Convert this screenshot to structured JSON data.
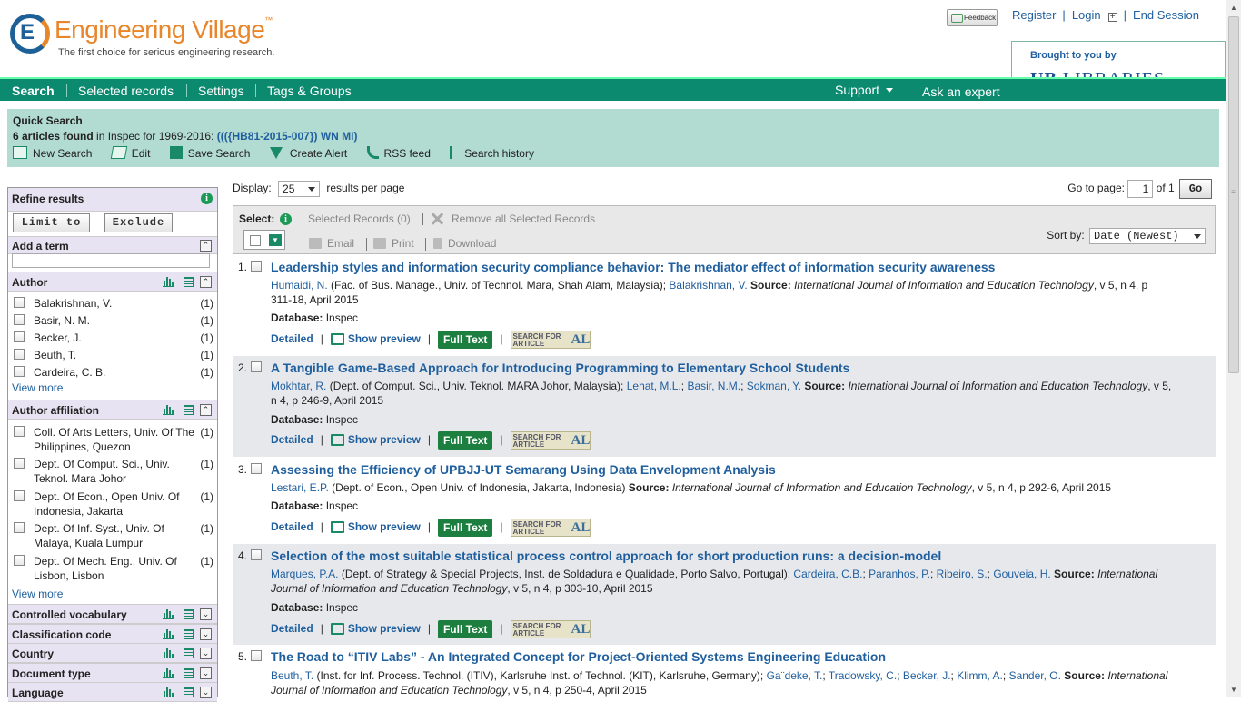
{
  "header": {
    "logo_title": "Engineering Village",
    "logo_tm": "™",
    "tagline": "The first choice for serious engineering research.",
    "feedback": "Feedback",
    "links": [
      "Register",
      "Login",
      "End Session"
    ],
    "brought_by": "Brought to you by",
    "library_ub": "UB",
    "library_name": "LIBRARIES"
  },
  "nav": {
    "items": [
      "Search",
      "Selected records",
      "Settings",
      "Tags & Groups"
    ],
    "support": "Support",
    "ask": "Ask an expert"
  },
  "quick_search": {
    "title": "Quick Search",
    "count_text": "6 articles found",
    "in_text": " in Inspec for 1969-2016: ",
    "query": "((({HB81-2015-007}) WN MI)",
    "actions": [
      "New Search",
      "Edit",
      "Save Search",
      "Create Alert",
      "RSS feed",
      "Search history"
    ]
  },
  "refine": {
    "title": "Refine results",
    "limit": "Limit to",
    "exclude": "Exclude",
    "add_term": "Add a term",
    "author_title": "Author",
    "authors": [
      {
        "name": "Balakrishnan, V.",
        "count": "(1)"
      },
      {
        "name": "Basir, N. M.",
        "count": "(1)"
      },
      {
        "name": "Becker, J.",
        "count": "(1)"
      },
      {
        "name": "Beuth, T.",
        "count": "(1)"
      },
      {
        "name": "Cardeira, C. B.",
        "count": "(1)"
      }
    ],
    "view_more": "View more",
    "affil_title": "Author affiliation",
    "affiliations": [
      {
        "name": "Coll. Of Arts Letters, Univ. Of The Philippines, Quezon",
        "count": "(1)"
      },
      {
        "name": "Dept. Of Comput. Sci., Univ. Teknol. Mara Johor",
        "count": "(1)"
      },
      {
        "name": "Dept. Of Econ., Open Univ. Of Indonesia, Jakarta",
        "count": "(1)"
      },
      {
        "name": "Dept. Of Inf. Syst., Univ. Of Malaya, Kuala Lumpur",
        "count": "(1)"
      },
      {
        "name": "Dept. Of Mech. Eng., Univ. Of Lisbon, Lisbon",
        "count": "(1)"
      }
    ],
    "collapsed": [
      "Controlled vocabulary",
      "Classification code",
      "Country",
      "Document type",
      "Language"
    ]
  },
  "results": {
    "display_label": "Display:",
    "per_page": "25",
    "per_page_label": "results per page",
    "goto_label": "Go to page:",
    "page": "1",
    "of_label": "of 1",
    "go": "Go",
    "select_label": "Select:",
    "selected_records": "Selected Records (0)",
    "remove_all": "Remove all Selected Records",
    "email": "Email",
    "print": "Print",
    "download": "Download",
    "sort_label": "Sort by:",
    "sort_value": "Date (Newest)",
    "detailed": "Detailed",
    "show_preview": "Show preview",
    "full_text": "Full Text",
    "sfa_line1": "SEARCH FOR",
    "sfa_line2": "ARTICLE",
    "sfa_al": "AL",
    "database_label": "Database:",
    "database_value": " Inspec",
    "source_label": "Source:",
    "records": [
      {
        "num": "1.",
        "title": "Leadership styles and information security compliance behavior: The mediator effect of information security awareness",
        "authors": [
          {
            "name": "Humaidi, N.",
            "aff": " (Fac. of Bus. Manage., Univ. of Technol. Mara, Shah Alam, Malaysia); "
          },
          {
            "name": "Balakrishnan, V.",
            "aff": " "
          }
        ],
        "source": "International Journal of Information and Education Technology",
        "source_rest": ", v 5, n 4, p 311-18, April 2015"
      },
      {
        "num": "2.",
        "title": "A Tangible Game-Based Approach for Introducing Programming to Elementary School Students",
        "authors": [
          {
            "name": "Mokhtar, R.",
            "aff": " (Dept. of Comput. Sci., Univ. Teknol. MARA Johor, Malaysia); "
          },
          {
            "name": "Lehat, M.L.",
            "aff": "; "
          },
          {
            "name": "Basir, N.M.",
            "aff": "; "
          },
          {
            "name": "Sokman, Y.",
            "aff": " "
          }
        ],
        "source": "International Journal of Information and Education Technology",
        "source_rest": ", v 5, n 4, p 246-9, April 2015"
      },
      {
        "num": "3.",
        "title": "Assessing the Efficiency of UPBJJ-UT Semarang Using Data Envelopment Analysis",
        "authors": [
          {
            "name": "Lestari, E.P.",
            "aff": " (Dept. of Econ., Open Univ. of Indonesia, Jakarta, Indonesia) "
          }
        ],
        "source": "International Journal of Information and Education Technology",
        "source_rest": ", v 5, n 4, p 292-6, April 2015"
      },
      {
        "num": "4.",
        "title": "Selection of the most suitable statistical process control approach for short production runs: a decision-model",
        "authors": [
          {
            "name": "Marques, P.A.",
            "aff": " (Dept. of Strategy & Special Projects, Inst. de Soldadura e Qualidade, Porto Salvo, Portugal); "
          },
          {
            "name": "Cardeira, C.B.",
            "aff": "; "
          },
          {
            "name": "Paranhos, P.",
            "aff": "; "
          },
          {
            "name": "Ribeiro, S.",
            "aff": "; "
          },
          {
            "name": "Gouveia, H.",
            "aff": " "
          }
        ],
        "source": "International Journal of Information and Education Technology",
        "source_rest": ", v 5, n 4, p 303-10, April 2015"
      },
      {
        "num": "5.",
        "title": "The Road to “ITIV Labs” - An Integrated Concept for Project-Oriented Systems Engineering Education",
        "authors": [
          {
            "name": "Beuth, T.",
            "aff": " (Inst. for Inf. Process. Technol. (ITIV), Karlsruhe Inst. of Technol. (KIT), Karlsruhe, Germany); "
          },
          {
            "name": "Ga¨deke, T.",
            "aff": "; "
          },
          {
            "name": "Tradowsky, C.",
            "aff": "; "
          },
          {
            "name": "Becker, J.",
            "aff": "; "
          },
          {
            "name": "Klimm, A.",
            "aff": "; "
          },
          {
            "name": "Sander, O.",
            "aff": " "
          }
        ],
        "source": "International Journal of Information and Education Technology",
        "source_rest": ", v 5, n 4, p 250-4, April 2015"
      }
    ]
  },
  "colors": {
    "nav": "#0c8a6f",
    "quick_search_bg": "#b2dbd1",
    "link": "#1f5f9e",
    "brand_orange": "#e8862b",
    "full_text": "#1d7f3f"
  }
}
